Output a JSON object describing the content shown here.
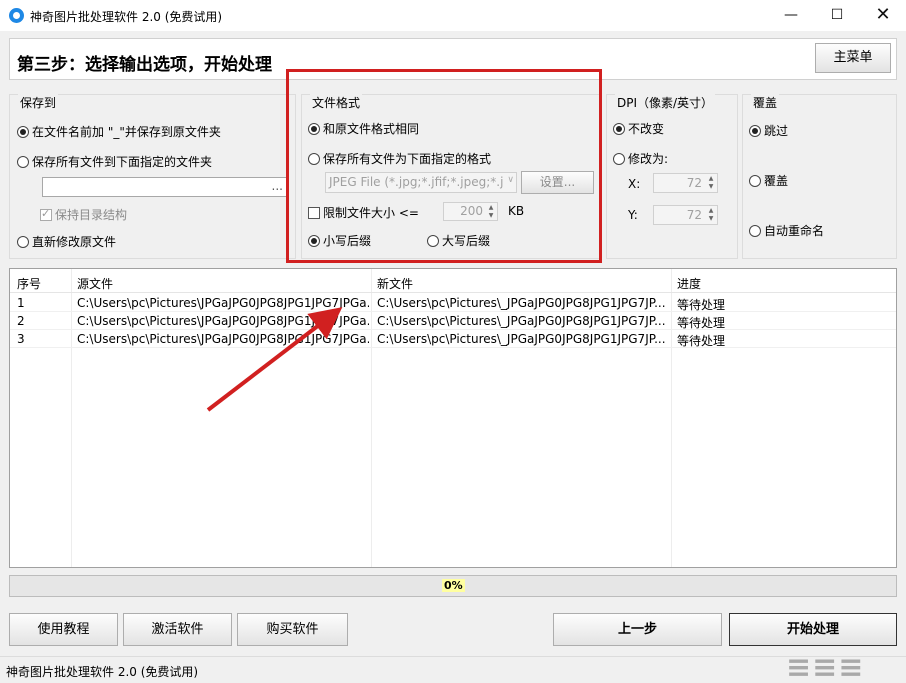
{
  "window": {
    "title": "神奇图片批处理软件 2.0 (免费试用)",
    "minimize_icon": "—",
    "maximize_icon": "☐",
    "close_icon": "✕"
  },
  "header": {
    "step_title": "第三步：选择输出选项，开始处理",
    "main_menu_label": "主菜单"
  },
  "save_to": {
    "title": "保存到",
    "opt_prefix": "在文件名前加 \"_\"并保存到原文件夹",
    "opt_folder": "保存所有文件到下面指定的文件夹",
    "folder_value": "",
    "browse_label": "...",
    "keep_structure": "保持目录结构",
    "opt_overwrite": "直新修改原文件"
  },
  "file_format": {
    "title": "文件格式",
    "opt_same": "和原文件格式相同",
    "opt_specified": "保存所有文件为下面指定的格式",
    "format_value": "JPEG File (*.jpg;*.jfif;*.jpeg;*.j",
    "settings_label": "设置...",
    "limit_size": "限制文件大小  <=",
    "size_value": "200",
    "size_unit": "KB",
    "opt_lower_ext": "小写后缀",
    "opt_upper_ext": "大写后缀"
  },
  "dpi": {
    "title": "DPI（像素/英寸）",
    "opt_keep": "不改变",
    "opt_change": "修改为:",
    "x_label": "X:",
    "x_value": "72",
    "y_label": "Y:",
    "y_value": "72"
  },
  "overwrite": {
    "title": "覆盖",
    "opt_skip": "跳过",
    "opt_cover": "覆盖",
    "opt_rename": "自动重命名"
  },
  "list": {
    "columns": [
      "序号",
      "源文件",
      "新文件",
      "进度"
    ],
    "rows": [
      [
        "1",
        "C:\\Users\\pc\\Pictures\\JPGaJPG0JPG8JPG1JPG7JPGa...",
        "C:\\Users\\pc\\Pictures\\_JPGaJPG0JPG8JPG1JPG7JP...",
        "等待处理"
      ],
      [
        "2",
        "C:\\Users\\pc\\Pictures\\JPGaJPG0JPG8JPG1JPG7JPGa...",
        "C:\\Users\\pc\\Pictures\\_JPGaJPG0JPG8JPG1JPG7JP...",
        "等待处理"
      ],
      [
        "3",
        "C:\\Users\\pc\\Pictures\\JPGaJPG0JPG8JPG1JPG7JPGa...",
        "C:\\Users\\pc\\Pictures\\_JPGaJPG0JPG8JPG1JPG7JP...",
        "等待处理"
      ]
    ]
  },
  "progress": {
    "label": "0%",
    "value": 0
  },
  "footer": {
    "tutorial_label": "使用教程",
    "activate_label": "激活软件",
    "buy_label": "购买软件",
    "prev_label": "上一步",
    "start_label": "开始处理"
  },
  "status": {
    "text": "神奇图片批处理软件 2.0 (免费试用)"
  },
  "annotation": {
    "color": "#d12020"
  }
}
